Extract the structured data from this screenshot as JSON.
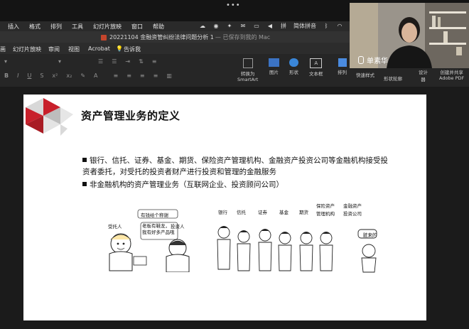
{
  "meeting": {
    "dots": "•••"
  },
  "menubar": {
    "items": [
      "插入",
      "格式",
      "排列",
      "工具",
      "幻灯片放映",
      "窗口",
      "帮助"
    ],
    "input_method": "简体拼音"
  },
  "window": {
    "title": "20221104 金融资管纠纷法律问题分析 1",
    "subtitle": "— 已保存到我的 Mac"
  },
  "ribbon_tabs": [
    "画",
    "幻灯片放映",
    "审阅",
    "视图",
    "Acrobat",
    "告诉我"
  ],
  "ribbon": {
    "convert_smartart": "转换为\nSmartArt",
    "picture": "图片",
    "shape": "形状",
    "textbox": "文本框",
    "arrange": "排列",
    "quick_styles": "快速样式",
    "shape_outline": "形状轮廓",
    "designer": "设计\n器",
    "create_share": "创建并共享\nAdobe PDF"
  },
  "webcam": {
    "name": "单素华"
  },
  "slide": {
    "title": "资产管理业务的定义",
    "bullets": [
      "银行、信托、证券、基金、期货、保险资产管理机构、金融资产投资公司等金融机构接受投资者委托，对受托的投资者财产进行投资和管理的金融服务",
      "非金融机构的资产管理业务（互联网企业、投资顾问公司）"
    ],
    "left_cartoon": {
      "speech_top": "有钱给个称谢",
      "speech_left": "老板有鞋龙，\n我有好多产品哦",
      "label_left": "受托人",
      "label_right": "投资人"
    },
    "right_cartoon": {
      "labels": [
        "银行",
        "信托",
        "证券",
        "基金",
        "期货",
        "保险资产\n管理机构",
        "金融资产\n投资公司"
      ],
      "speech": "脏来的"
    }
  },
  "colors": {
    "slide_accent": "#c8202b",
    "app_dark": "#262626",
    "ppt_red": "#c4452c"
  }
}
